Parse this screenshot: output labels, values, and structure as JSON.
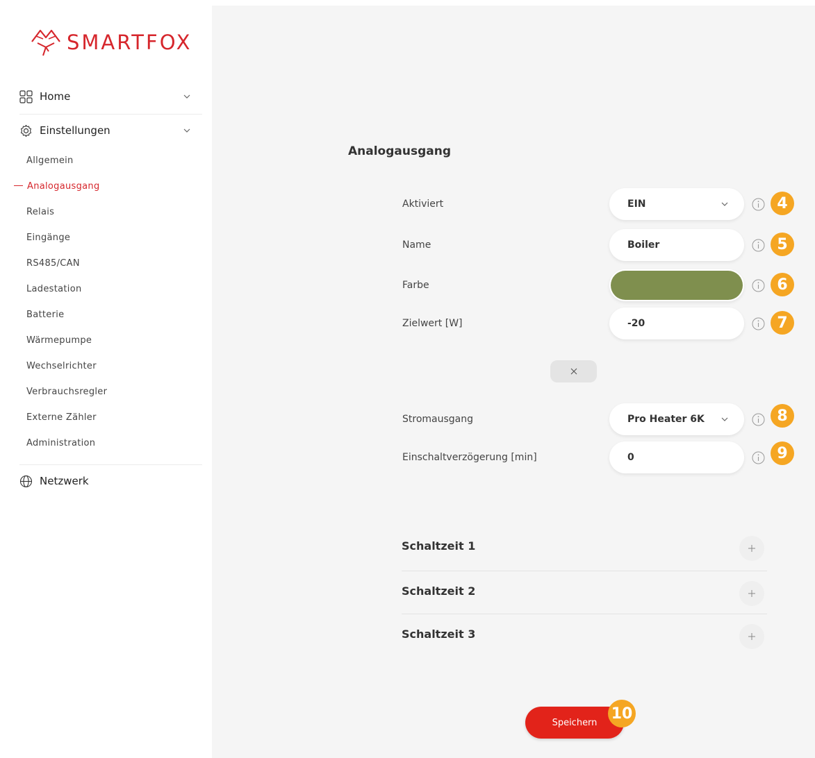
{
  "brand": {
    "name": "SMARTFOX",
    "color": "#d6262c"
  },
  "nav": {
    "home_label": "Home",
    "settings_label": "Einstellungen",
    "network_label": "Netzwerk",
    "sub_items": [
      {
        "label": "Allgemein"
      },
      {
        "label": "Analogausgang",
        "active": true
      },
      {
        "label": "Relais"
      },
      {
        "label": "Eingänge"
      },
      {
        "label": "RS485/CAN"
      },
      {
        "label": "Ladestation"
      },
      {
        "label": "Batterie"
      },
      {
        "label": "Wärmepumpe"
      },
      {
        "label": "Wechselrichter"
      },
      {
        "label": "Verbrauchsregler"
      },
      {
        "label": "Externe Zähler"
      },
      {
        "label": "Administration"
      }
    ]
  },
  "form": {
    "title": "Analogausgang",
    "aktiviert": {
      "label": "Aktiviert",
      "value": "EIN",
      "badge": "4"
    },
    "name": {
      "label": "Name",
      "value": "Boiler",
      "badge": "5"
    },
    "farbe": {
      "label": "Farbe",
      "value": "#7f8f4e",
      "badge": "6"
    },
    "zielwert": {
      "label": "Zielwert [W]",
      "value": "-20",
      "badge": "7"
    },
    "stromausgang": {
      "label": "Stromausgang",
      "value": "Pro Heater 6K",
      "badge": "8"
    },
    "einschalt": {
      "label": "Einschaltverzögerung [min]",
      "value": "0",
      "badge": "9"
    }
  },
  "schedules": [
    {
      "title": "Schaltzeit 1"
    },
    {
      "title": "Schaltzeit 2"
    },
    {
      "title": "Schaltzeit 3"
    }
  ],
  "save": {
    "label": "Speichern",
    "badge": "10"
  },
  "colors": {
    "accent": "#e2231a",
    "badge": "#f5a623"
  }
}
